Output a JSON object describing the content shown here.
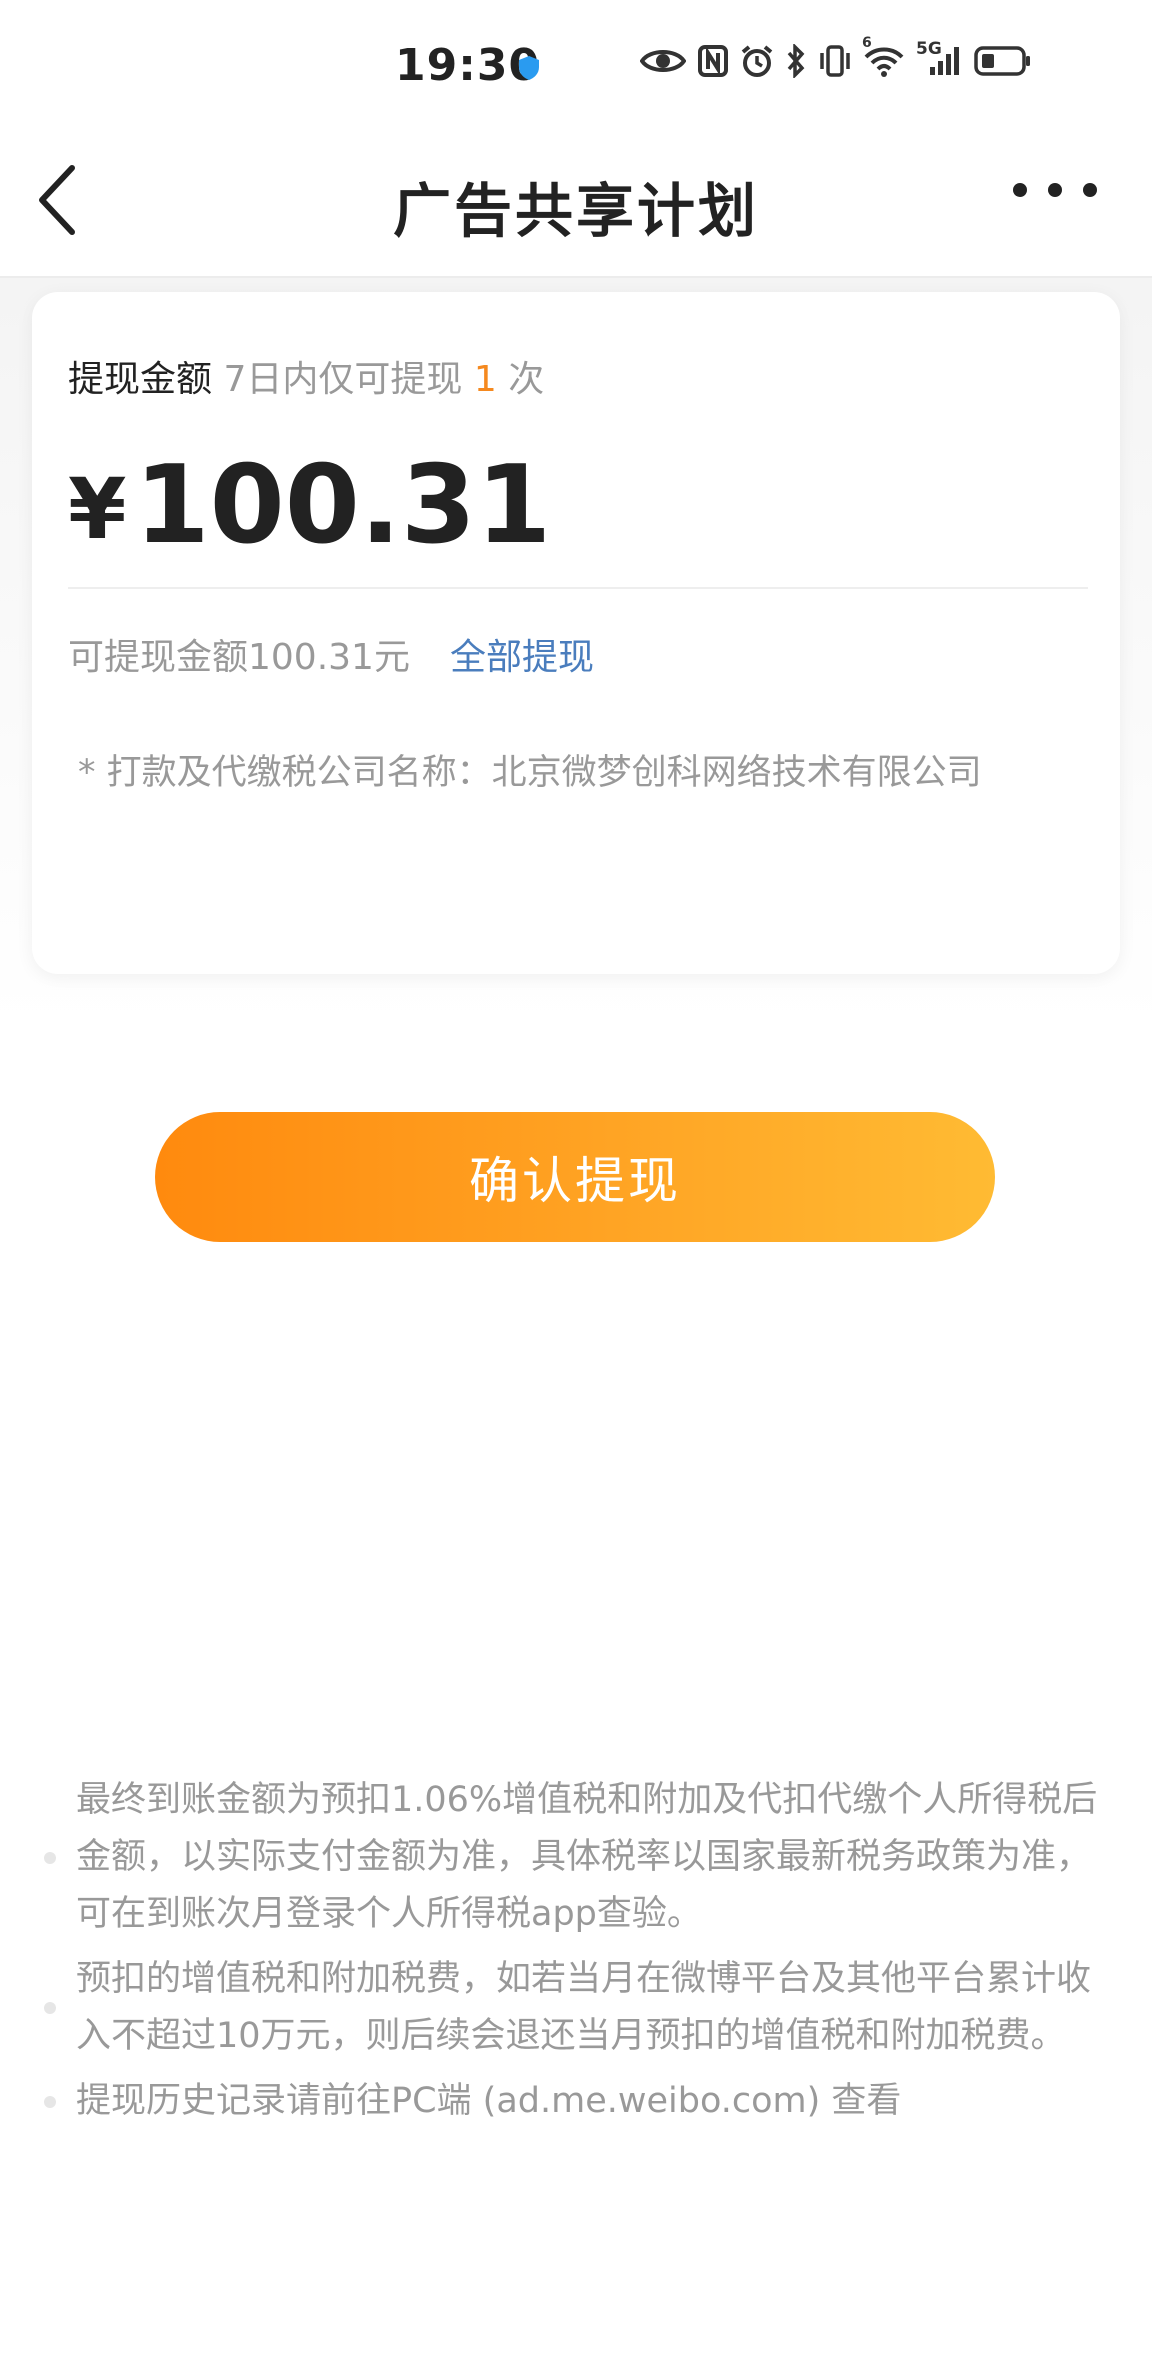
{
  "status_bar": {
    "time": "19:30",
    "icons": [
      "shield-icon",
      "eye-icon",
      "nfc-icon",
      "alarm-icon",
      "bluetooth-icon",
      "vibrate-icon",
      "wifi-icon",
      "signal-5g-icon",
      "battery-icon"
    ],
    "network_label": "5G",
    "wifi_label": "6"
  },
  "nav": {
    "title": "广告共享计划",
    "back_icon": "chevron-left-icon",
    "more_icon": "more-dots-icon"
  },
  "card": {
    "header_label": "提现金额",
    "limit_prefix": "7日内仅可提现",
    "limit_count": "1",
    "limit_suffix": "次",
    "currency_symbol": "¥",
    "amount": "100.31",
    "available_text": "可提现金额100.31元",
    "withdraw_all_label": "全部提现",
    "company_note": "* 打款及代缴税公司名称：北京微梦创科网络技术有限公司"
  },
  "confirm_button": {
    "label": "确认提现"
  },
  "notes": [
    {
      "lines": [
        "最终到账金额为预扣1.06%增值税和附加及代扣代缴个人所得税后",
        "金额，以实际支付金额为准，具体税率以国家最新税务政策为准，",
        "可在到账次月登录个人所得税app查验。"
      ]
    },
    {
      "lines": [
        "预扣的增值税和附加税费，如若当月在微博平台及其他平台累计收",
        "入不超过10万元，则后续会退还当月预扣的增值税和附加税费。"
      ]
    },
    {
      "lines": [
        "提现历史记录请前往PC端 (ad.me.weibo.com) 查看"
      ]
    }
  ],
  "colors": {
    "accent_orange": "#f5891f",
    "link_blue": "#4a7dbd",
    "button_gradient_start": "#ff8a0e",
    "button_gradient_end": "#ffbb33"
  }
}
